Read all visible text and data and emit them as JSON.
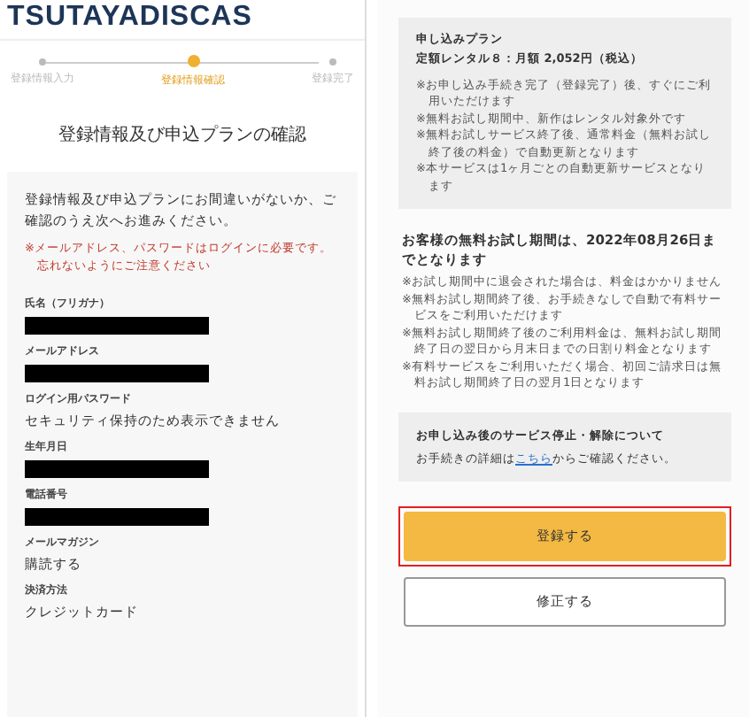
{
  "logo": "TSUTAYADISCAS",
  "steps": [
    {
      "label": "登録情報入力",
      "selected": false
    },
    {
      "label": "登録情報確認",
      "selected": true
    },
    {
      "label": "登録完了",
      "selected": false
    }
  ],
  "page_title": "登録情報及び申込プランの確認",
  "intro": "登録情報及び申込プランにお間違いがないか、ご確認のうえ次へお進みください。",
  "warning": "※メールアドレス、パスワードはログインに必要です。忘れないようにご注意ください",
  "fields": [
    {
      "label": "氏名（フリガナ）",
      "kind": "redacted"
    },
    {
      "label": "メールアドレス",
      "kind": "redacted"
    },
    {
      "label": "ログイン用パスワード",
      "kind": "text",
      "value": "セキュリティ保持のため表示できません"
    },
    {
      "label": "生年月日",
      "kind": "redacted"
    },
    {
      "label": "電話番号",
      "kind": "redacted"
    },
    {
      "label": "メールマガジン",
      "kind": "text",
      "value": "購読する"
    },
    {
      "label": "決済方法",
      "kind": "text",
      "value": "クレジットカード"
    }
  ],
  "plan": {
    "heading": "申し込みプラン",
    "name": "定額レンタル８：月額 2,052円（税込）",
    "notes": [
      "※お申し込み手続き完了（登録完了）後、すぐにご利用いただけます",
      "※無料お試し期間中、新作はレンタル対象外です",
      "※無料お試しサービス終了後、通常料金（無料お試し終了後の料金）で自動更新となります",
      "※本サービスは1ヶ月ごとの自動更新サービスとなります"
    ]
  },
  "trial": {
    "heading": "お客様の無料お試し期間は、2022年08月26日までとなります",
    "notes": [
      "※お試し期間中に退会された場合は、料金はかかりません",
      "※無料お試し期間終了後、お手続きなしで自動で有料サービスをご利用いただけます",
      "※無料お試し期間終了後のご利用料金は、無料お試し期間終了日の翌日から月末日までの日割り料金となります",
      "※有料サービスをご利用いただく場合、初回ご請求日は無料お試し期間終了日の翌月1日となります"
    ]
  },
  "cancel": {
    "heading": "お申し込み後のサービス停止・解除について",
    "text_before": "お手続きの詳細は",
    "link": "こちら",
    "text_after": "からご確認ください。"
  },
  "buttons": [
    {
      "label": "登録する",
      "kind": "primary",
      "highlighted": true
    },
    {
      "label": "修正する",
      "kind": "secondary",
      "highlighted": false
    }
  ]
}
